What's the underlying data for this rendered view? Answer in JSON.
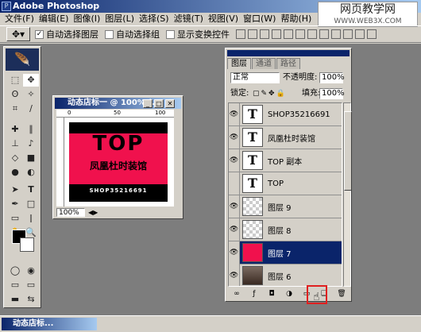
{
  "app": {
    "title": "Adobe Photoshop"
  },
  "watermark": {
    "line1": "网页教学网",
    "line2": "WWW.WEB3X.COM"
  },
  "menu": [
    "文件(F)",
    "编辑(E)",
    "图像(I)",
    "图层(L)",
    "选择(S)",
    "滤镜(T)",
    "视图(V)",
    "窗口(W)",
    "帮助(H)"
  ],
  "options": {
    "auto_select_layer": "自动选择图层",
    "auto_select_group": "自动选择组",
    "show_transform": "显示变换控件"
  },
  "document": {
    "title": "动态店标一 @ 100% (...",
    "zoom": "100%",
    "ruler_marks": [
      "0",
      "50",
      "100"
    ],
    "design": {
      "big": "TOP",
      "cn": "凤凰杜时装馆",
      "sub": "SHOP35216691"
    },
    "colors": {
      "pink": "#f0114d",
      "black": "#000000"
    }
  },
  "layers_panel": {
    "tabs": [
      "图层",
      "通道",
      "路径"
    ],
    "blend_mode": "正常",
    "opacity_label": "不透明度:",
    "opacity": "100%",
    "lock_label": "锁定:",
    "fill_label": "填充:",
    "fill": "100%",
    "layers": [
      {
        "name": "SHOP35216691",
        "thumb": "T",
        "visible": true
      },
      {
        "name": "凤凰杜时装馆",
        "thumb": "T",
        "visible": true
      },
      {
        "name": "TOP 副本",
        "thumb": "T",
        "visible": true
      },
      {
        "name": "TOP",
        "thumb": "T",
        "visible": false
      },
      {
        "name": "图层 9",
        "thumb": "checker",
        "visible": true
      },
      {
        "name": "图层 8",
        "thumb": "checker",
        "visible": true
      },
      {
        "name": "图层 7",
        "thumb": "pink",
        "visible": true,
        "selected": true
      },
      {
        "name": "图层 6",
        "thumb": "photo",
        "visible": true
      }
    ]
  },
  "taskbar": {
    "item": "动态店标..."
  }
}
